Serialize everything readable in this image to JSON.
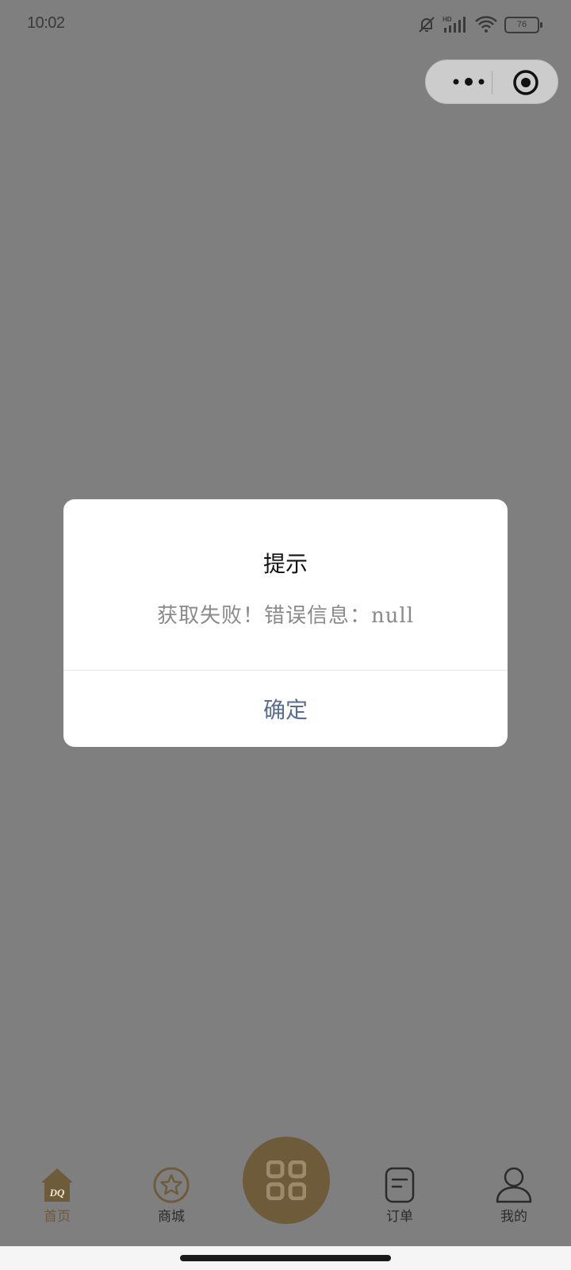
{
  "status_bar": {
    "time": "10:02",
    "battery": "76",
    "icons": [
      "bell-muted-icon",
      "hd-signal-icon",
      "wifi-icon",
      "battery-icon"
    ]
  },
  "capsule": {
    "more_icon": "more-dots-icon",
    "close_icon": "target-circle-icon"
  },
  "dialog": {
    "title": "提示",
    "message": "获取失败！错误信息：null",
    "confirm_label": "确定"
  },
  "tabbar": {
    "items": [
      {
        "label": "首页",
        "icon": "home-dq-icon",
        "active": true
      },
      {
        "label": "商城",
        "icon": "star-circle-icon",
        "active": false
      },
      {
        "label": "",
        "icon": "qr-scan-icon",
        "active": false
      },
      {
        "label": "订单",
        "icon": "order-list-icon",
        "active": false
      },
      {
        "label": "我的",
        "icon": "profile-icon",
        "active": false
      }
    ],
    "home_logo_text": "DQ"
  },
  "colors": {
    "overlay": "#7f7f7f",
    "accent_brown": "#6e5b3a",
    "confirm_text": "#586c94"
  }
}
